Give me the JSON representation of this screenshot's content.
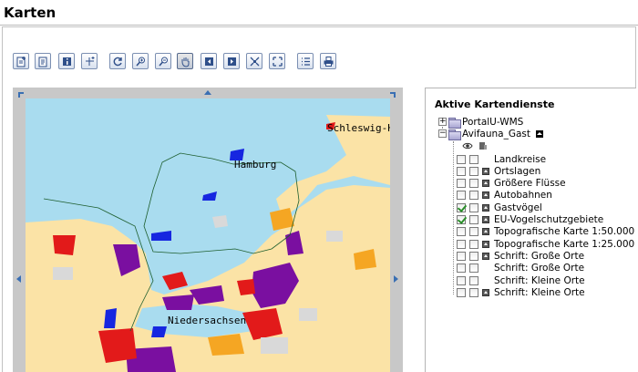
{
  "page": {
    "title": "Karten"
  },
  "toolbar": {
    "buttons": [
      {
        "name": "add-service-button",
        "icon": "add-document-icon"
      },
      {
        "name": "edit-service-button",
        "icon": "edit-document-icon"
      },
      {
        "name": "info-button",
        "icon": "info-icon"
      },
      {
        "name": "add-point-button",
        "icon": "crosshair-plus-icon"
      },
      {
        "name": "refresh-button",
        "icon": "refresh-icon"
      },
      {
        "name": "zoom-in-button",
        "icon": "zoom-in-icon"
      },
      {
        "name": "zoom-out-button",
        "icon": "zoom-out-icon"
      },
      {
        "name": "pan-button",
        "icon": "hand-icon",
        "active": true
      },
      {
        "name": "back-button",
        "icon": "arrow-left-icon"
      },
      {
        "name": "forward-button",
        "icon": "arrow-right-icon"
      },
      {
        "name": "zoom-full-button",
        "icon": "collapse-arrows-icon"
      },
      {
        "name": "zoom-extent-button",
        "icon": "expand-arrows-icon"
      },
      {
        "name": "legend-button",
        "icon": "list-icon"
      },
      {
        "name": "print-button",
        "icon": "printer-icon"
      }
    ]
  },
  "map": {
    "labels": {
      "schleswig": "Schleswig-H",
      "hamburg": "Hamburg",
      "niedersachsen": "Niedersachsen"
    },
    "colors": {
      "sea": "#a9dcef",
      "land": "#fbe3a6",
      "purple": "#7a0fa0",
      "red": "#e21a1a",
      "orange": "#f5a623",
      "blue": "#1626e0"
    }
  },
  "services_panel": {
    "title": "Aktive Kartendienste",
    "services": [
      {
        "label": "PortalU-WMS",
        "expanded": false
      },
      {
        "label": "Avifauna_Gast",
        "expanded": true
      }
    ],
    "layers": [
      {
        "label": "Landkreise",
        "checked": false,
        "has_arrow": false
      },
      {
        "label": "Ortslagen",
        "checked": false,
        "has_arrow": true
      },
      {
        "label": "Größere Flüsse",
        "checked": false,
        "has_arrow": true
      },
      {
        "label": "Autobahnen",
        "checked": false,
        "has_arrow": true
      },
      {
        "label": "Gastvögel",
        "checked": true,
        "has_arrow": true
      },
      {
        "label": "EU-Vogelschutzgebiete",
        "checked": true,
        "has_arrow": true
      },
      {
        "label": "Topografische Karte 1:50.000",
        "checked": false,
        "has_arrow": true
      },
      {
        "label": "Topografische Karte 1:25.000",
        "checked": false,
        "has_arrow": true
      },
      {
        "label": "Schrift: Große Orte",
        "checked": false,
        "has_arrow": true
      },
      {
        "label": "Schrift: Große Orte",
        "checked": false,
        "has_arrow": false
      },
      {
        "label": "Schrift: Kleine Orte",
        "checked": false,
        "has_arrow": false
      },
      {
        "label": "Schrift: Kleine Orte",
        "checked": false,
        "has_arrow": true
      }
    ]
  }
}
